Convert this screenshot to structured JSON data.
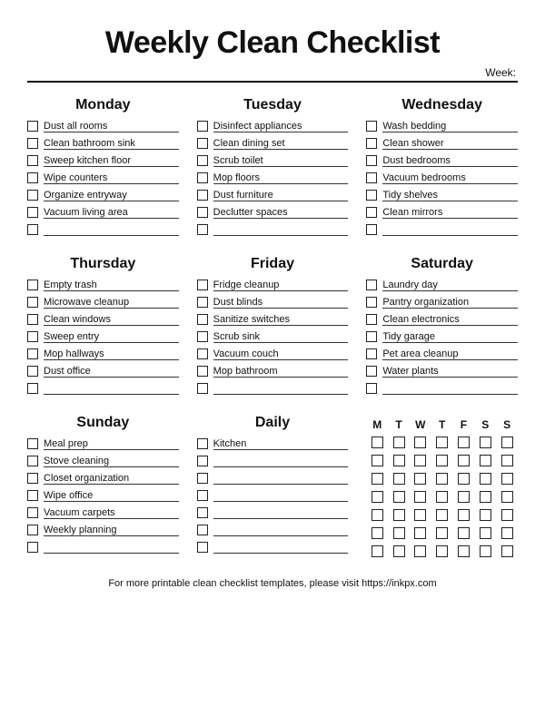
{
  "title": "Weekly Clean Checklist",
  "week_label": "Week:",
  "footer": "For more printable clean checklist templates, please visit https://inkpx.com",
  "habit_header": [
    "M",
    "T",
    "W",
    "T",
    "F",
    "S",
    "S"
  ],
  "days": [
    {
      "name": "Monday",
      "tasks": [
        "Dust all rooms",
        "Clean bathroom sink",
        "Sweep kitchen floor",
        "Wipe counters",
        "Organize entryway",
        "Vacuum living area",
        ""
      ]
    },
    {
      "name": "Tuesday",
      "tasks": [
        "Disinfect appliances",
        "Clean dining set",
        "Scrub toilet",
        "Mop floors",
        "Dust furniture",
        "Declutter spaces",
        ""
      ]
    },
    {
      "name": "Wednesday",
      "tasks": [
        "Wash bedding",
        "Clean shower",
        "Dust bedrooms",
        "Vacuum bedrooms",
        "Tidy shelves",
        "Clean mirrors",
        ""
      ]
    },
    {
      "name": "Thursday",
      "tasks": [
        "Empty trash",
        "Microwave cleanup",
        "Clean windows",
        "Sweep entry",
        "Mop hallways",
        "Dust office",
        ""
      ]
    },
    {
      "name": "Friday",
      "tasks": [
        "Fridge cleanup",
        "Dust blinds",
        "Sanitize switches",
        "Scrub sink",
        "Vacuum couch",
        "Mop bathroom",
        ""
      ]
    },
    {
      "name": "Saturday",
      "tasks": [
        "Laundry day",
        "Pantry organization",
        "Clean electronics",
        "Tidy garage",
        "Pet area cleanup",
        "Water plants",
        ""
      ]
    },
    {
      "name": "Sunday",
      "tasks": [
        "Meal prep",
        "Stove cleaning",
        "Closet organization",
        "Wipe office",
        "Vacuum carpets",
        "Weekly planning",
        ""
      ]
    },
    {
      "name": "Daily",
      "tasks": [
        "Kitchen",
        "",
        "",
        "",
        "",
        "",
        ""
      ]
    }
  ]
}
